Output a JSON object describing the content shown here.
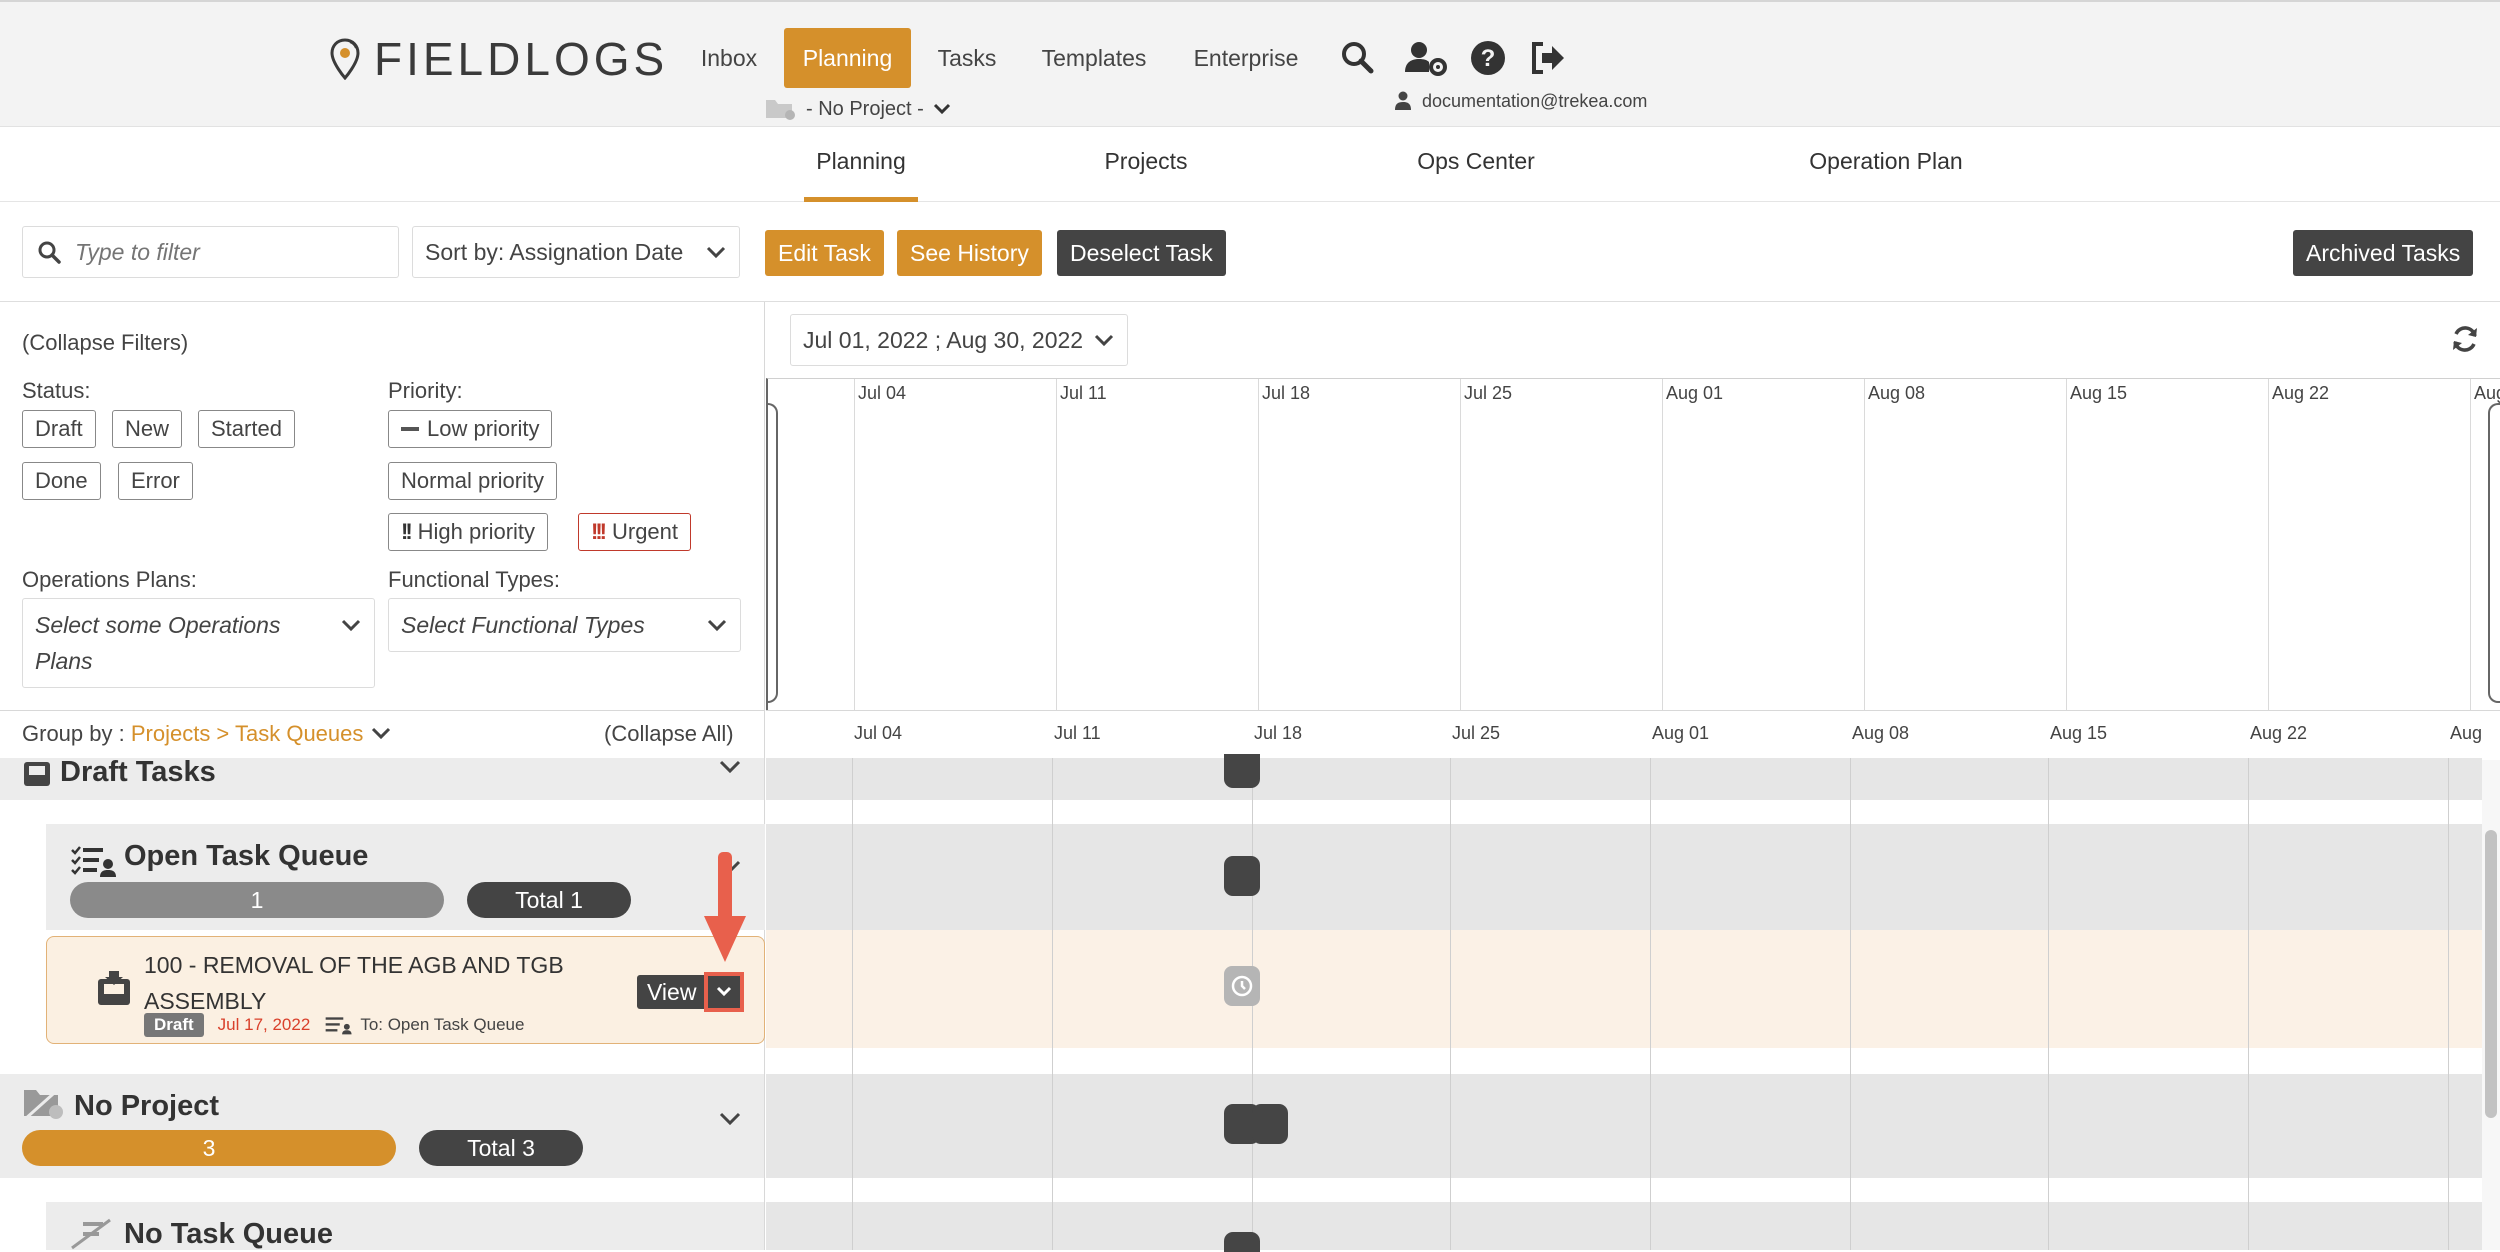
{
  "header": {
    "brand": "FIELDLOGS",
    "nav": [
      "Inbox",
      "Planning",
      "Tasks",
      "Templates",
      "Enterprise"
    ],
    "active_nav": "Planning",
    "project_switch": "- No Project -",
    "user_email": "documentation@trekea.com"
  },
  "subnav": {
    "tabs": [
      "Planning",
      "Projects",
      "Ops Center",
      "Operation Plan"
    ],
    "active": "Planning"
  },
  "toolbar": {
    "filter_placeholder": "Type to filter",
    "sort_label": "Sort by: Assignation Date",
    "edit_task": "Edit Task",
    "see_history": "See History",
    "deselect_task": "Deselect Task",
    "archived_tasks": "Archived Tasks"
  },
  "filters": {
    "collapse": "(Collapse Filters)",
    "status_label": "Status:",
    "statuses": [
      "Draft",
      "New",
      "Started",
      "Done",
      "Error"
    ],
    "priority_label": "Priority:",
    "priorities": [
      "Low priority",
      "Normal priority",
      "High priority",
      "Urgent"
    ],
    "ops_plans_label": "Operations Plans:",
    "ops_plans_placeholder": "Select some Operations Plans",
    "func_types_label": "Functional Types:",
    "func_types_placeholder": "Select Functional Types"
  },
  "timeline": {
    "date_range": "Jul 01, 2022 ; Aug 30, 2022",
    "ticks": [
      "Jul 04",
      "Jul 11",
      "Jul 18",
      "Jul 25",
      "Aug 01",
      "Aug 08",
      "Aug 15",
      "Aug 22",
      "Aug"
    ]
  },
  "grouping": {
    "group_by_label": "Group by :",
    "group_by_value": "Projects > Task Queues",
    "collapse_all": "(Collapse All)"
  },
  "groups": {
    "draft_title": "Draft Tasks",
    "open_queue_title": "Open Task Queue",
    "open_queue_count": "1",
    "open_queue_total": "Total 1",
    "task_title": "100 - REMOVAL OF THE AGB AND TGB ASSEMBLY",
    "task_status": "Draft",
    "task_date": "Jul 17, 2022",
    "task_queue": "To: Open Task Queue",
    "task_view": "View",
    "no_project_title": "No Project",
    "no_project_count": "3",
    "no_project_total": "Total 3",
    "no_queue_title": "No Task Queue"
  },
  "colors": {
    "accent": "#d5902b",
    "dark": "#444444",
    "urgent": "#c0392b",
    "highlight_arrow": "#e8604c"
  }
}
